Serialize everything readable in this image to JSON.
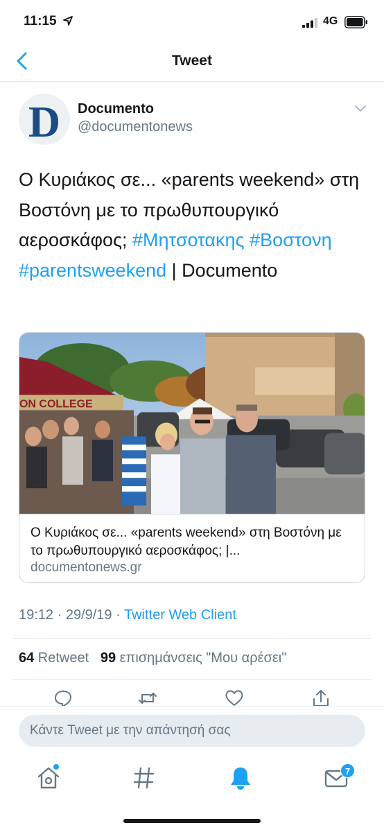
{
  "status_bar": {
    "time": "11:15",
    "network": "4G"
  },
  "nav": {
    "title": "Tweet"
  },
  "author": {
    "avatar_letter": "D",
    "display_name": "Documento",
    "handle": "@documentonews"
  },
  "tweet": {
    "text_part1": "Ο Κυριάκος σε... «parents weekend» στη Βοστόνη με το πρωθυπουργικό αεροσκάφος; ",
    "hashtag1": "#Μητσοτακης",
    "hashtag2": "#Βοστονη",
    "hashtag3": "#parentsweekend",
    "text_part2": " | Documento"
  },
  "card": {
    "image_banner_text": "ON COLLEGE",
    "title": "Ο Κυριάκος σε... «parents weekend» στη Βοστόνη με το πρωθυπουργικό αεροσκάφος; |...",
    "domain": "documentonews.gr"
  },
  "meta": {
    "timestamp": "19:12 · 29/9/19 · ",
    "client": "Twitter Web Client"
  },
  "stats": {
    "retweets_count": "64",
    "retweets_label": " Retweet",
    "likes_count": "99",
    "likes_label": " επισημάνσεις \"Μου αρέσει\""
  },
  "reply": {
    "placeholder": "Κάντε Tweet με την απάντησή σας"
  },
  "tab_bar": {
    "items": [
      "home-icon",
      "explore-hashtag-icon",
      "notifications-bell-icon",
      "messages-envelope-icon"
    ],
    "messages_badge": "7"
  },
  "colors": {
    "accent": "#1da1f2",
    "text": "#14171a",
    "secondary": "#657786",
    "brand_blue": "#1b4c86"
  }
}
